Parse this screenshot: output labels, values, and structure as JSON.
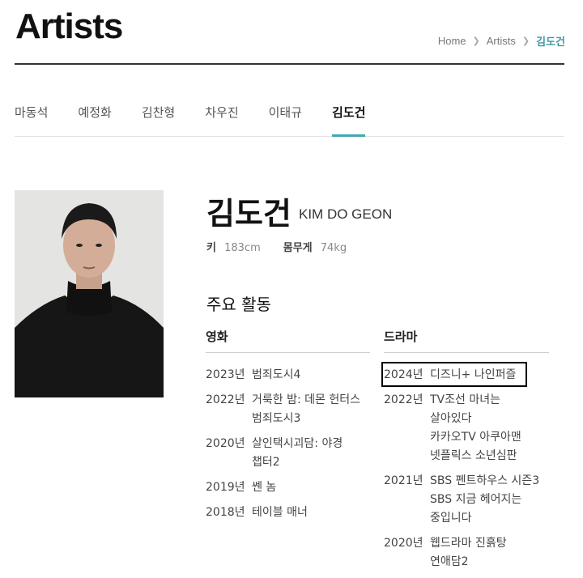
{
  "header": {
    "title": "Artists",
    "breadcrumb": [
      "Home",
      "Artists",
      "김도건"
    ]
  },
  "tabs": [
    "마동석",
    "예정화",
    "김찬형",
    "차우진",
    "이태규",
    "김도건"
  ],
  "active_tab": "김도건",
  "profile": {
    "name_ko": "김도건",
    "name_en": "KIM DO GEON",
    "height_label": "키",
    "height_value": "183cm",
    "weight_label": "몸무게",
    "weight_value": "74kg"
  },
  "activities": {
    "title": "주요 활동",
    "movie": {
      "heading": "영화",
      "rows": [
        {
          "year": "2023년",
          "titles": [
            "범죄도시4"
          ]
        },
        {
          "year": "2022년",
          "titles": [
            "거룩한 밤: 데몬 헌터스",
            "범죄도시3"
          ]
        },
        {
          "year": "2020년",
          "titles": [
            "살인택시괴담: 야경",
            "챕터2"
          ]
        },
        {
          "year": "2019년",
          "titles": [
            "쎈 놈"
          ]
        },
        {
          "year": "2018년",
          "titles": [
            "테이블 매너"
          ]
        }
      ]
    },
    "drama": {
      "heading": "드라마",
      "rows": [
        {
          "year": "2024년",
          "titles": [
            "디즈니+ 나인퍼즐"
          ]
        },
        {
          "year": "2022년",
          "titles": [
            "TV조선 마녀는",
            "살아있다",
            "카카오TV 아쿠아맨",
            "넷플릭스 소년심판"
          ]
        },
        {
          "year": "2021년",
          "titles": [
            "SBS 펜트하우스 시즌3",
            "SBS 지금 헤어지는",
            "중입니다"
          ]
        },
        {
          "year": "2020년",
          "titles": [
            "웹드라마 진흙탕",
            "연애담2"
          ]
        }
      ]
    }
  },
  "colors": {
    "accent": "#45a8b0",
    "breadcrumb_active": "#3c9aa3"
  }
}
